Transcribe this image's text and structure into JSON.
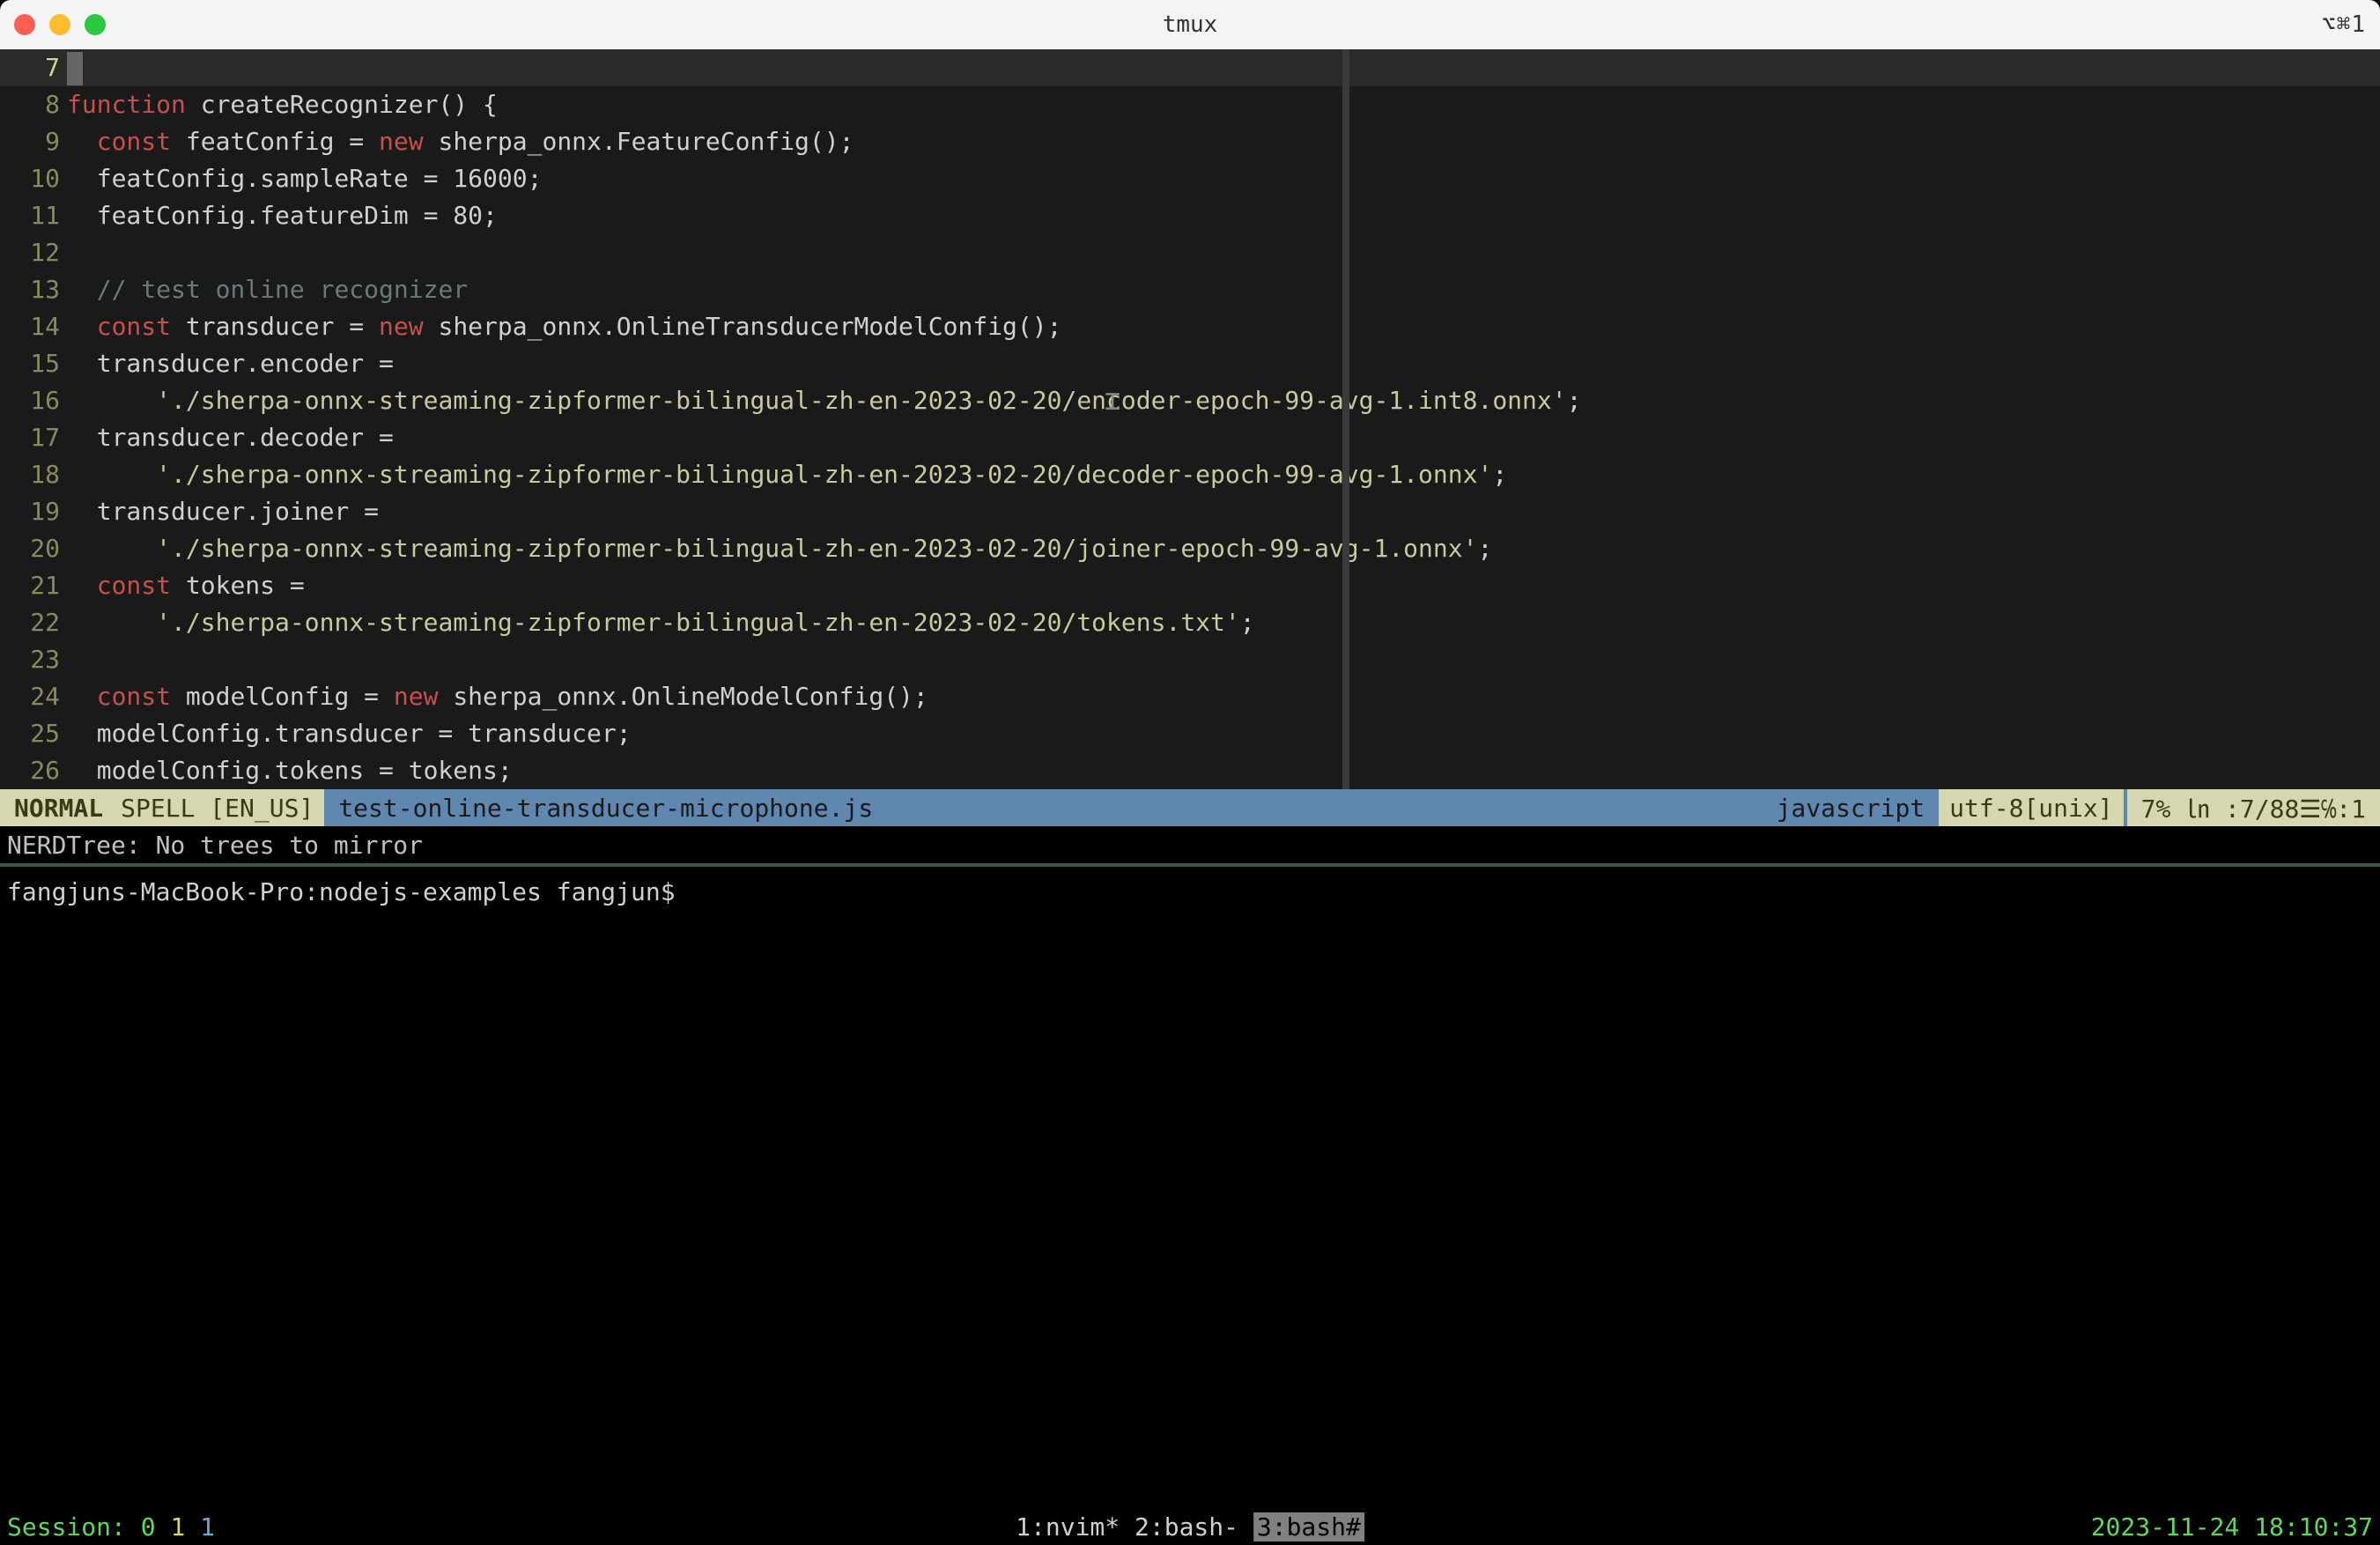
{
  "titlebar": {
    "title": "tmux",
    "right": "⌥⌘1"
  },
  "code": {
    "lines": [
      {
        "num": "7",
        "tokens": [
          {
            "cls": "cursor",
            "text": ""
          }
        ]
      },
      {
        "num": "8",
        "tokens": [
          {
            "cls": "kw-keyword",
            "text": "function"
          },
          {
            "cls": "kw-punct",
            "text": " createRecognizer() {"
          }
        ]
      },
      {
        "num": "9",
        "tokens": [
          {
            "cls": "kw-punct",
            "text": "  "
          },
          {
            "cls": "kw-keyword",
            "text": "const"
          },
          {
            "cls": "kw-punct",
            "text": " featConfig = "
          },
          {
            "cls": "kw-keyword",
            "text": "new"
          },
          {
            "cls": "kw-punct",
            "text": " sherpa_onnx.FeatureConfig();"
          }
        ]
      },
      {
        "num": "10",
        "tokens": [
          {
            "cls": "kw-punct",
            "text": "  featConfig.sampleRate = 16000;"
          }
        ]
      },
      {
        "num": "11",
        "tokens": [
          {
            "cls": "kw-punct",
            "text": "  featConfig.featureDim = 80;"
          }
        ]
      },
      {
        "num": "12",
        "tokens": []
      },
      {
        "num": "13",
        "tokens": [
          {
            "cls": "kw-punct",
            "text": "  "
          },
          {
            "cls": "kw-comment",
            "text": "// test online recognizer"
          }
        ]
      },
      {
        "num": "14",
        "tokens": [
          {
            "cls": "kw-punct",
            "text": "  "
          },
          {
            "cls": "kw-keyword",
            "text": "const"
          },
          {
            "cls": "kw-punct",
            "text": " transducer = "
          },
          {
            "cls": "kw-keyword",
            "text": "new"
          },
          {
            "cls": "kw-punct",
            "text": " sherpa_onnx.OnlineTransducerModelConfig();"
          }
        ]
      },
      {
        "num": "15",
        "tokens": [
          {
            "cls": "kw-punct",
            "text": "  transducer.encoder ="
          }
        ]
      },
      {
        "num": "16",
        "tokens": [
          {
            "cls": "kw-punct",
            "text": "      "
          },
          {
            "cls": "kw-string",
            "text": "'./sherpa-onnx-streaming-zipformer-bilingual-zh-en-2023-02-20/encoder-epoch-99-avg-1.int8.onnx'"
          },
          {
            "cls": "kw-punct",
            "text": ";"
          }
        ]
      },
      {
        "num": "17",
        "tokens": [
          {
            "cls": "kw-punct",
            "text": "  transducer.decoder ="
          }
        ]
      },
      {
        "num": "18",
        "tokens": [
          {
            "cls": "kw-punct",
            "text": "      "
          },
          {
            "cls": "kw-string",
            "text": "'./sherpa-onnx-streaming-zipformer-bilingual-zh-en-2023-02-20/decoder-epoch-99-avg-1.onnx'"
          },
          {
            "cls": "kw-punct",
            "text": ";"
          }
        ]
      },
      {
        "num": "19",
        "tokens": [
          {
            "cls": "kw-punct",
            "text": "  transducer.joiner ="
          }
        ]
      },
      {
        "num": "20",
        "tokens": [
          {
            "cls": "kw-punct",
            "text": "      "
          },
          {
            "cls": "kw-string",
            "text": "'./sherpa-onnx-streaming-zipformer-bilingual-zh-en-2023-02-20/joiner-epoch-99-avg-1.onnx'"
          },
          {
            "cls": "kw-punct",
            "text": ";"
          }
        ]
      },
      {
        "num": "21",
        "tokens": [
          {
            "cls": "kw-punct",
            "text": "  "
          },
          {
            "cls": "kw-keyword",
            "text": "const"
          },
          {
            "cls": "kw-punct",
            "text": " tokens ="
          }
        ]
      },
      {
        "num": "22",
        "tokens": [
          {
            "cls": "kw-punct",
            "text": "      "
          },
          {
            "cls": "kw-string",
            "text": "'./sherpa-onnx-streaming-zipformer-bilingual-zh-en-2023-02-20/tokens.txt'"
          },
          {
            "cls": "kw-punct",
            "text": ";"
          }
        ]
      },
      {
        "num": "23",
        "tokens": []
      },
      {
        "num": "24",
        "tokens": [
          {
            "cls": "kw-punct",
            "text": "  "
          },
          {
            "cls": "kw-keyword",
            "text": "const"
          },
          {
            "cls": "kw-punct",
            "text": " modelConfig = "
          },
          {
            "cls": "kw-keyword",
            "text": "new"
          },
          {
            "cls": "kw-punct",
            "text": " sherpa_onnx.OnlineModelConfig();"
          }
        ]
      },
      {
        "num": "25",
        "tokens": [
          {
            "cls": "kw-punct",
            "text": "  modelConfig.transducer = transducer;"
          }
        ]
      },
      {
        "num": "26",
        "tokens": [
          {
            "cls": "kw-punct",
            "text": "  modelConfig.tokens = tokens;"
          }
        ]
      }
    ]
  },
  "statusline": {
    "mode": "NORMAL",
    "spell": "SPELL [EN_US]",
    "file": "test-online-transducer-microphone.js",
    "filetype": "javascript",
    "encoding": "utf-8[unix]",
    "position": "7% ㏑ :7/88☰℅:1"
  },
  "cmdline": "NERDTree: No trees to mirror",
  "shell": {
    "prompt": "fangjuns-MacBook-Pro:nodejs-examples fangjun$ "
  },
  "tmux": {
    "session_label": "Session: ",
    "session_nums": [
      "0",
      "1",
      "1"
    ],
    "windows": [
      {
        "text": "1:nvim* ",
        "active": false
      },
      {
        "text": "2:bash- ",
        "active": false
      },
      {
        "text": "3:bash#",
        "active": true
      }
    ],
    "datetime": "2023-11-24 18:10:37"
  },
  "cursor_glyph": "⌶"
}
